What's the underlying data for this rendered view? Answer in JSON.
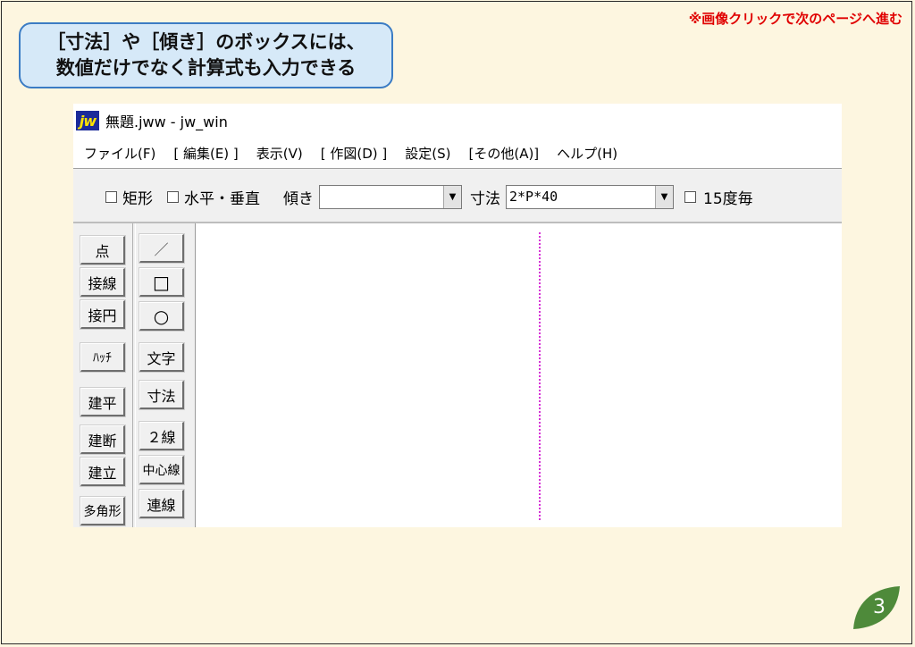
{
  "nav_hint": "※画像クリックで次のページへ進む",
  "callout": {
    "line1": "［寸法］や［傾き］のボックスには、",
    "line2": "数値だけでなく計算式も入力できる"
  },
  "window": {
    "icon_text": "jw",
    "title": "無題.jww - jw_win"
  },
  "menu": [
    "ファイル(F)",
    "[ 編集(E) ]",
    "表示(V)",
    "[ 作図(D) ]",
    "設定(S)",
    "[その他(A)]",
    "ヘルプ(H)"
  ],
  "toolbar": {
    "rect_label": "矩形",
    "hv_label": "水平・垂直",
    "angle_label": "傾き",
    "angle_value": "",
    "dim_label": "寸法",
    "dim_value": "2*P*40",
    "deg15_label": "15度毎"
  },
  "tools_left": [
    "点",
    "接線",
    "接円",
    "ﾊｯﾁ",
    "建平",
    "建断",
    "建立",
    "多角形"
  ],
  "tools_right": [
    "／",
    "□",
    "○",
    "文字",
    "寸法",
    "２線",
    "中心線",
    "連線"
  ],
  "colors": {
    "accent_red": "#e00000",
    "callout_bg": "#d6e9f8",
    "callout_border": "#3b7cc4",
    "guide_line": "#d633d6",
    "leaf_green": "#4e8a3a"
  },
  "page_number": "3"
}
